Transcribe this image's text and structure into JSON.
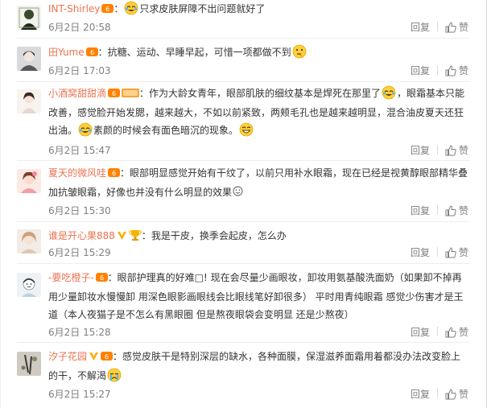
{
  "actions": {
    "reply": "回复",
    "like": "赞"
  },
  "comments": [
    {
      "user": "INT-Shirley",
      "pre": "：",
      "text": "只求皮肤屏障不出问题就好了",
      "text2": "",
      "date": "6月2日 20:58"
    },
    {
      "user": "田Yume",
      "pre": "：抗糖、运动、早睡早起，可惜一项都做不到",
      "text": "",
      "text2": "",
      "date": "6月2日 17:03"
    },
    {
      "user": "小酒窝甜甜滴",
      "pre": "：作为大龄女青年，眼部肌肤的细纹基本是焊死在那里了",
      "text": "，眼霜基本只能改善，感觉脸开始发腮，越来越大，不如以前紧致，两颊毛孔也是越来越明显，混合油皮夏天还狂出油。",
      "text2": "素颜的时候会有面色暗沉的现象。",
      "date": "6月2日 15:47"
    },
    {
      "user": "夏天的微风哇",
      "pre": "：眼部明显感觉开始有干纹了，以前只用补水眼霜，现在已经是视黄醇眼部精华叠加抗皱眼霜，好像也并没有什么明显的效果",
      "text": "",
      "text2": "",
      "date": "6月2日 15:30"
    },
    {
      "user": "谁是开心果888",
      "pre": "：我是干皮，换季会起皮，怎么办",
      "text": "",
      "text2": "",
      "date": "6月2日 15:29"
    },
    {
      "user": "-要吃橙子-",
      "pre": "：眼部护理真的好难□! 现在会尽量少画眼妆，卸妆用氨基酸洗面奶（如果卸不掉再用少量卸妆水慢慢卸 用深色眼影画眼线会比眼线笔好卸很多） 平时用青纯眼霜 感觉少伤害才是王道（本人夜猫子是不怎么有黑眼圈 但是熬夜眼袋会变明显 还是少熬夜）",
      "text": "",
      "text2": "",
      "date": "6月2日 15:28"
    },
    {
      "user": "汐子花园",
      "pre": "：感觉皮肤干是特别深层的缺水，各种面膜，保湿滋养面霜用着都没办法改变脸上的干，不解渴",
      "text": "",
      "text2": "",
      "date": "6月2日 15:27"
    }
  ]
}
